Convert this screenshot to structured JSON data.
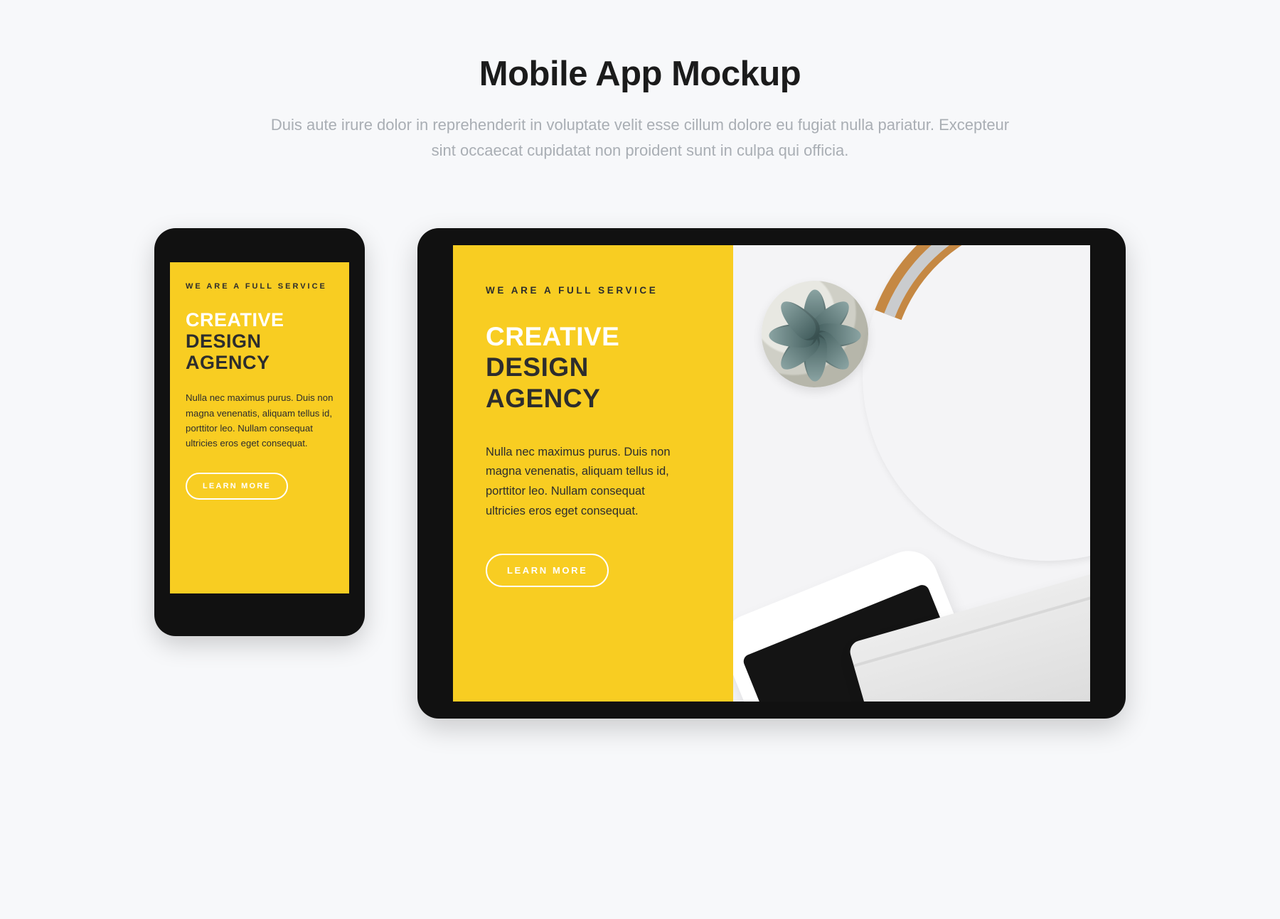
{
  "header": {
    "title": "Mobile App Mockup",
    "subtitle": "Duis aute irure dolor in reprehenderit in voluptate velit esse cillum dolore eu fugiat nulla pariatur. Excepteur sint occaecat cupidatat non proident sunt in culpa qui officia."
  },
  "phone": {
    "eyebrow": "WE ARE A FULL SERVICE",
    "title_line1": "CREATIVE",
    "title_line2": "DESIGN",
    "title_line3": "AGENCY",
    "body": "Nulla nec maximus purus. Duis non magna venenatis, aliquam tellus id, porttitor leo. Nullam consequat ultricies eros eget consequat.",
    "cta": "LEARN MORE"
  },
  "tablet": {
    "eyebrow": "WE ARE A FULL SERVICE",
    "title_line1": "CREATIVE",
    "title_line2": "DESIGN",
    "title_line3": "AGENCY",
    "body": "Nulla nec maximus purus. Duis non magna venenatis, aliquam tellus id, porttitor leo. Nullam consequat ultricies eros eget consequat.",
    "cta": "LEARN MORE"
  },
  "colors": {
    "accent": "#f8cd22",
    "device": "#111111",
    "page_bg": "#f7f8fa"
  }
}
